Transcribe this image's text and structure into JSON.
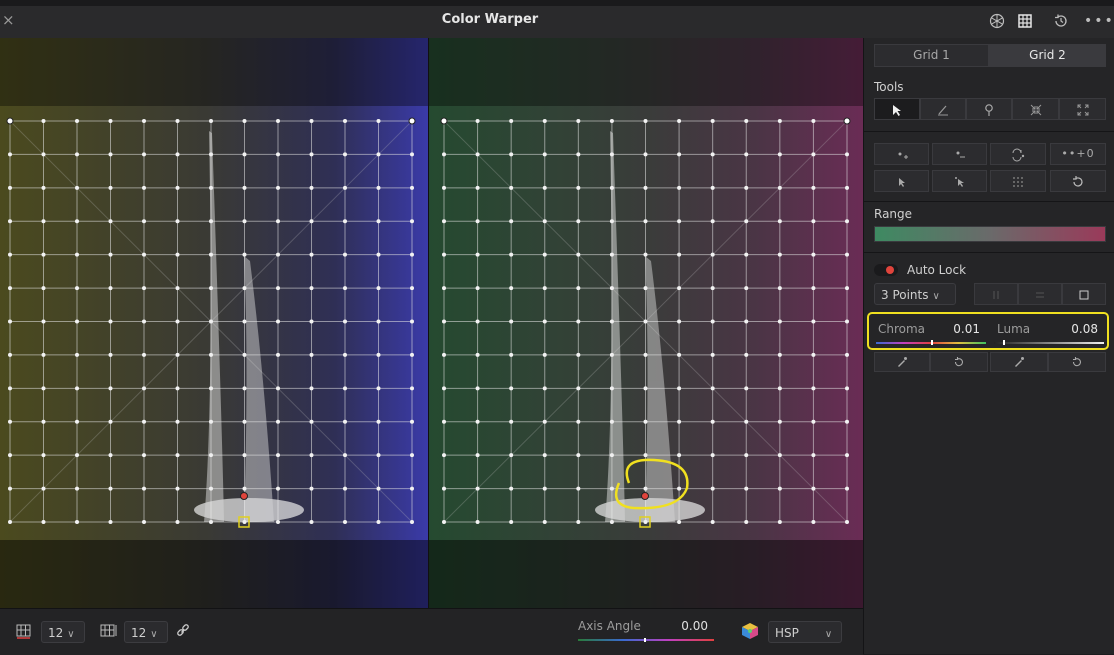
{
  "window": {
    "title": "Color Warper",
    "close_glyph": "×"
  },
  "title_icons": [
    "color-wheel-icon",
    "grid-icon",
    "history-icon",
    "more-icon"
  ],
  "colors": {
    "highlight": "#f0e020",
    "accent_red": "#e0443c",
    "range_start": "#3e8a62",
    "range_end": "#9a3a5a"
  },
  "inspector": {
    "tabs": [
      {
        "label": "Grid 1"
      },
      {
        "label": "Grid 2",
        "active": true
      }
    ],
    "tools_label": "Tools",
    "tools": [
      "pointer-icon",
      "pen-icon",
      "pin-icon",
      "collapse-icon",
      "expand-icon"
    ],
    "actions_row1": [
      "add-point-icon",
      "remove-point-icon",
      "swap-icon",
      "expand-points-icon"
    ],
    "actions_row1_text": "••+0",
    "actions_row2": [
      "select-icon",
      "select-all-icon",
      "grid-select-icon",
      "reset-icon"
    ],
    "range_label": "Range",
    "auto_lock_label": "Auto Lock",
    "points_select": "3 Points",
    "chroma": {
      "label": "Chroma",
      "value": "0.01"
    },
    "luma": {
      "label": "Luma",
      "value": "0.08"
    }
  },
  "bottom": {
    "grid_h_value": "12",
    "grid_v_value": "12",
    "axis_angle_label": "Axis Angle",
    "axis_angle_value": "0.00",
    "color_space": "HSP"
  }
}
